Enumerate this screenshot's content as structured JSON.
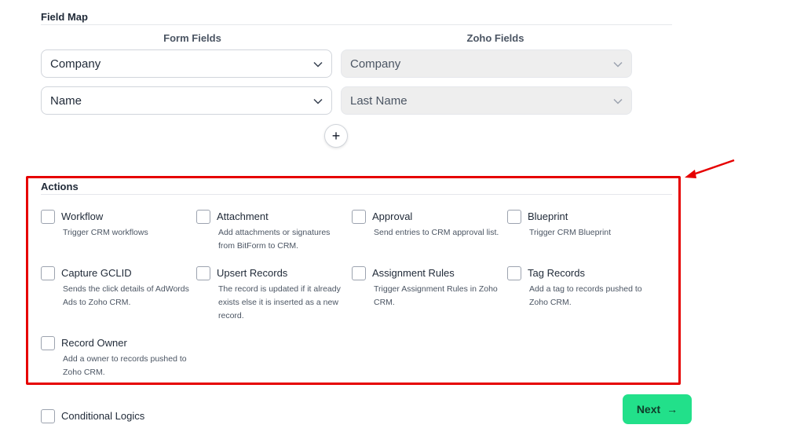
{
  "field_map": {
    "title": "Field Map",
    "form_fields_header": "Form Fields",
    "zoho_fields_header": "Zoho Fields",
    "rows": [
      {
        "form_field": "Company",
        "zoho_field": "Company"
      },
      {
        "form_field": "Name",
        "zoho_field": "Last Name"
      }
    ],
    "add_button": "+"
  },
  "actions": {
    "title": "Actions",
    "items": [
      {
        "label": "Workflow",
        "desc": "Trigger CRM workflows"
      },
      {
        "label": "Attachment",
        "desc": "Add attachments or signatures from BitForm to CRM."
      },
      {
        "label": "Approval",
        "desc": "Send entries to CRM approval list."
      },
      {
        "label": "Blueprint",
        "desc": "Trigger CRM Blueprint"
      },
      {
        "label": "Capture GCLID",
        "desc": "Sends the click details of AdWords Ads to Zoho CRM."
      },
      {
        "label": "Upsert Records",
        "desc": "The record is updated if it already exists else it is inserted as a new record."
      },
      {
        "label": "Assignment Rules",
        "desc": "Trigger Assignment Rules in Zoho CRM."
      },
      {
        "label": "Tag Records",
        "desc": "Add a tag to records pushed to Zoho CRM."
      },
      {
        "label": "Record Owner",
        "desc": "Add a owner to records pushed to Zoho CRM."
      }
    ]
  },
  "conditional_logics": {
    "label": "Conditional Logics"
  },
  "next_button": {
    "label": "Next",
    "arrow": "→"
  },
  "colors": {
    "highlight": "#e60000",
    "next_bg": "#22e08a"
  }
}
